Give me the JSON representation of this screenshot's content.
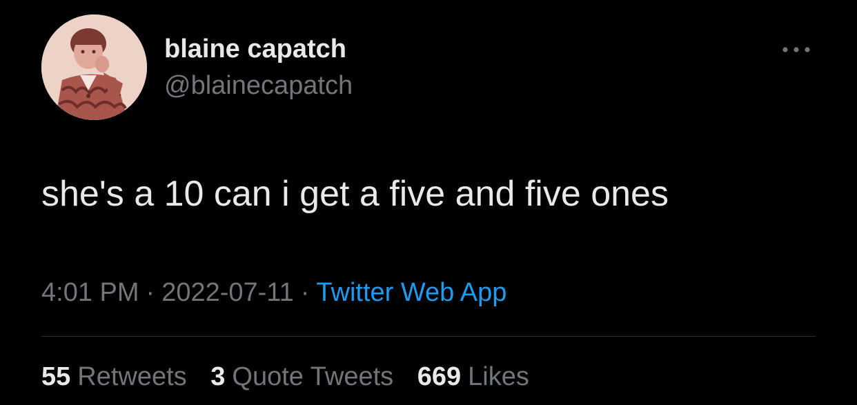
{
  "author": {
    "display_name": "blaine capatch",
    "handle": "@blainecapatch",
    "avatar_icon": "child-portrait-avatar"
  },
  "more_icon": "more-horizontal-icon",
  "tweet": {
    "text": "she's a 10 can i get a five and five ones"
  },
  "meta": {
    "time": "4:01 PM",
    "separator": "·",
    "date": "2022-07-11",
    "source": "Twitter Web App"
  },
  "stats": {
    "retweets": {
      "count": "55",
      "label": "Retweets"
    },
    "quote_tweets": {
      "count": "3",
      "label": "Quote Tweets"
    },
    "likes": {
      "count": "669",
      "label": "Likes"
    }
  },
  "colors": {
    "background": "#000000",
    "primary_text": "#e7e9ea",
    "secondary_text": "#71767b",
    "link": "#1d9bf0",
    "divider": "#2f3336"
  }
}
